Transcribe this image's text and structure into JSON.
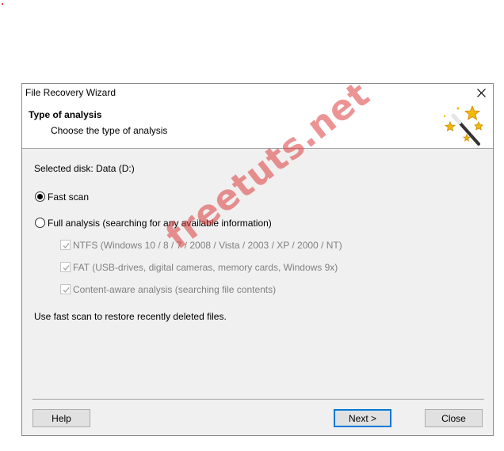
{
  "window": {
    "title": "File Recovery Wizard"
  },
  "header": {
    "title": "Type of analysis",
    "subtitle": "Choose the type of analysis",
    "icon": "magic-wand-icon"
  },
  "content": {
    "selected_disk": "Selected disk: Data (D:)",
    "options": [
      {
        "label": "Fast scan",
        "checked": true,
        "enabled": true
      },
      {
        "label": "Full analysis (searching for any available information)",
        "checked": false,
        "enabled": true
      }
    ],
    "sub_options": [
      {
        "label": "NTFS (Windows 10 / 8 / 7 / 2008 / Vista / 2003 / XP / 2000 / NT)",
        "checked": true,
        "enabled": false
      },
      {
        "label": "FAT (USB-drives, digital cameras, memory cards, Windows 9x)",
        "checked": true,
        "enabled": false
      },
      {
        "label": "Content-aware analysis (searching file contents)",
        "checked": true,
        "enabled": false
      }
    ],
    "hint": "Use fast scan to restore recently deleted files."
  },
  "buttons": {
    "help": "Help",
    "next": "Next >",
    "close": "Close"
  },
  "watermark": "freetuts.net",
  "colors": {
    "accent": "#0078d7",
    "watermark": "#dc3c3c"
  }
}
